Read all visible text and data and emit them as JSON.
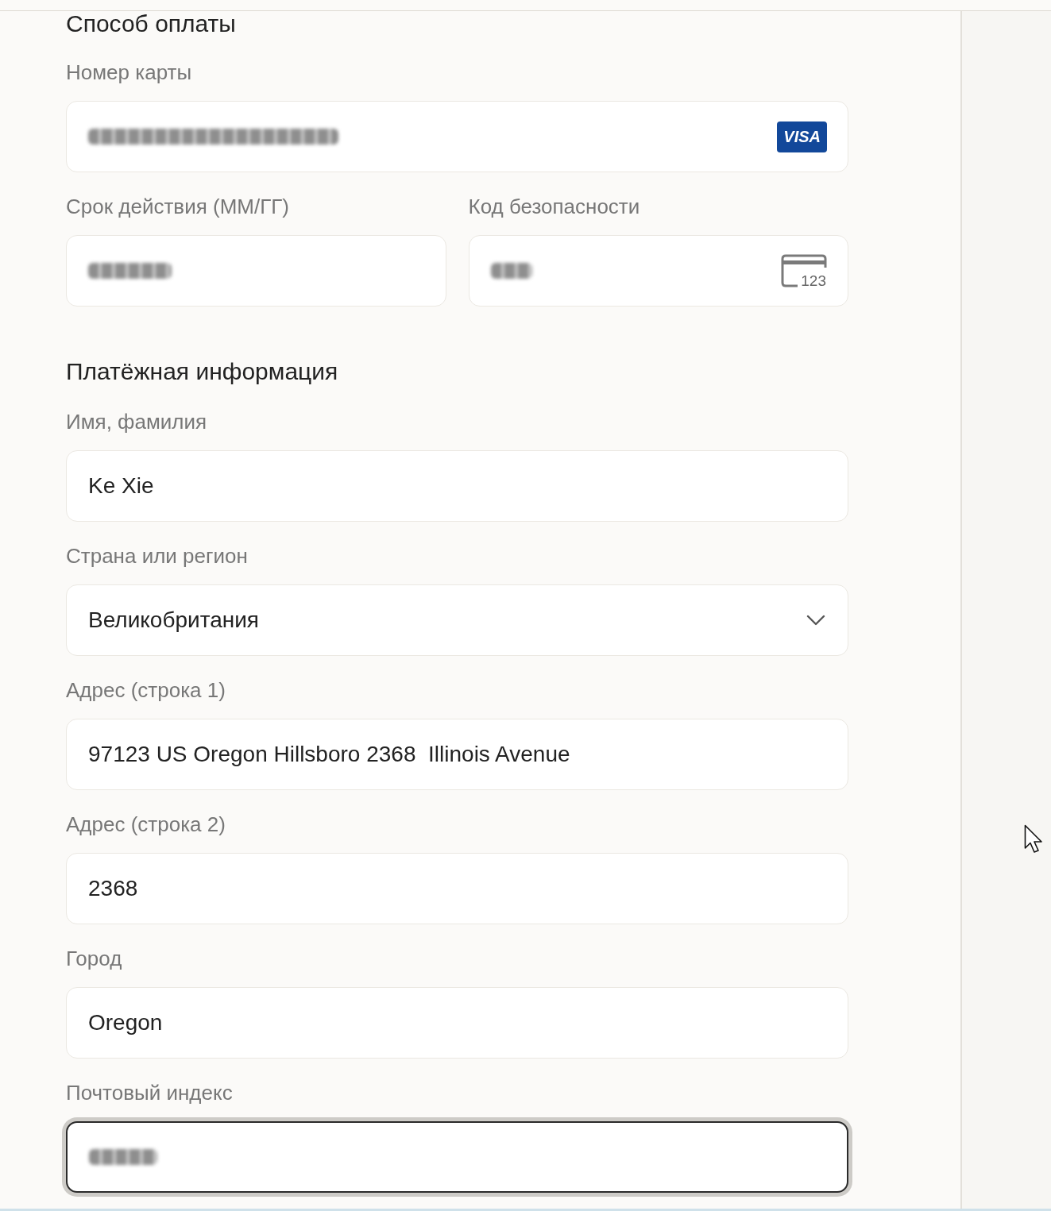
{
  "sections": [
    {
      "title": "Способ оплаты",
      "rows": [
        {
          "fields": [
            {
              "label": "Номер карты",
              "kind": "card_number",
              "badge": "VISA",
              "focused": false
            }
          ]
        },
        {
          "fields": [
            {
              "label": "Срок действия (ММ/ГГ)",
              "kind": "expiry",
              "focused": false
            },
            {
              "label": "Код безопасности",
              "kind": "security_code",
              "icon_label": "123",
              "focused": false
            }
          ]
        }
      ]
    },
    {
      "title": "Платёжная информация",
      "rows": [
        {
          "fields": [
            {
              "label": "Имя, фамилия",
              "kind": "text",
              "value": "Ke Xie",
              "focused": false
            }
          ]
        },
        {
          "fields": [
            {
              "label": "Страна или регион",
              "kind": "select",
              "value": "Великобритания",
              "focused": false
            }
          ]
        },
        {
          "fields": [
            {
              "label": "Адрес (строка 1)",
              "kind": "text",
              "value": "97123 US Oregon Hillsboro 2368  Illinois Avenue",
              "focused": false
            }
          ]
        },
        {
          "fields": [
            {
              "label": "Адрес (строка 2)",
              "kind": "text",
              "value": "2368",
              "focused": false
            }
          ]
        },
        {
          "fields": [
            {
              "label": "Город",
              "kind": "text",
              "value": "Oregon",
              "focused": false
            }
          ]
        },
        {
          "fields": [
            {
              "label": "Почтовый индекс",
              "kind": "postal_code",
              "focused": true
            }
          ]
        }
      ]
    }
  ]
}
